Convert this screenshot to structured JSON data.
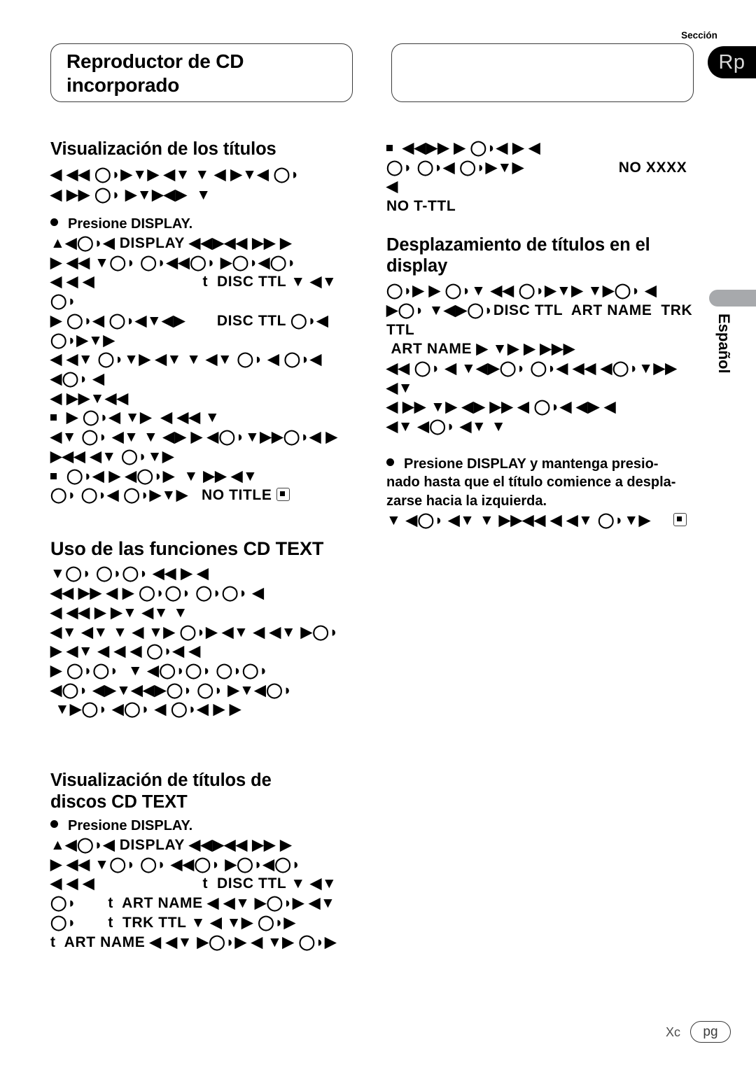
{
  "document": {
    "header": {
      "title": "Reproductor de CD\nincorporado",
      "section_label": "Sección",
      "section_badge": "Rp",
      "blank_box": ""
    },
    "side_tab": {
      "language": "Español"
    },
    "footer": {
      "code": "Xc",
      "page_badge": "pg"
    }
  },
  "left_column": {
    "heading_1": "Visualización de los títulos",
    "intro_lines": [
      "◀ ◀◀ ◯◗▶▼▶ ◀▼ ▼ ◀ ▶▼◀ ◯◗",
      "◀ ▶▶ ◯◗ ▶▼▶◀▶  ▼"
    ],
    "bullet_1": "Presione DISPLAY.",
    "body_1": [
      "▲◀◯◗◀ DISPLAY ◀◀▶◀◀ ▶▶ ▶",
      "▶ ◀◀ ▼◯◗ ◯◗◀◀◯◗ ▶◯◗◀◯◗",
      "◀ ◀ ◀                        t  DISC TTL ▼ ◀▼",
      "◯◗",
      "▶ ◯◗◀ ◯◗◀▼◀▶       DISC TTL ◯◗◀ ◯◗▶▼▶",
      "◀ ◀▼ ◯◗▼▶ ◀▼ ▼ ◀▼ ◯◗ ◀ ◯◗◀ ◀◯◗ ◀",
      "◀ ▶▶▼◀◀"
    ],
    "sub_note_1": [
      "▶ ◯◗◀ ▼▶  ◀ ◀◀ ▼",
      "◀▼ ◯◗ ◀▼ ▼ ◀▶ ▶ ◀◯◗▼▶▶◯◗◀ ▶",
      "▶◀◀ ◀▼ ◯◗▼▶"
    ],
    "sub_note_2": [
      "◯◗◀ ▶ ◀◯◗▶  ▼ ▶▶ ◀▼",
      "◯◗ ◯◗◀ ◯◗▶▼▶   NO TITLE"
    ],
    "heading_2": "Uso de las funciones CD TEXT",
    "body_2": [
      "▼◯◗ ◯◗◯◗ ◀◀ ▶ ◀",
      "◀◀ ▶▶ ◀ ▶ ◯◗◯◗ ◯◗◯◗ ◀",
      "◀ ◀◀ ▶ ▶▼ ◀▼ ▼",
      "◀▼ ◀▼ ▼ ◀ ▼▶ ◯◗▶ ◀▼ ◀ ◀▼ ▶◯◗",
      "▶ ◀▼ ◀ ◀ ◀ ◯◗◀ ◀",
      "▶ ◯◗◯◗  ▼ ◀◯◗◯◗ ◯◗◯◗",
      "◀◯◗ ◀▶▼◀◀▶◯◗ ◯◗ ▶▼◀◯◗",
      " ▼▶◯◗ ◀◯◗ ◀ ◯◗◀ ▶ ▶"
    ],
    "heading_3": "Visualización de títulos de\ndiscos CD TEXT",
    "bullet_2": "Presione DISPLAY.",
    "body_3": [
      "▲◀◯◗◀ DISPLAY ◀◀▶◀◀ ▶▶ ▶",
      "▶ ◀◀ ▼◯◗ ◯◗ ◀◀◯◗ ▶◯◗◀◯◗",
      "◀ ◀ ◀                        t  DISC TTL ▼ ◀▼",
      "◯◗       t  ART NAME ◀ ◀▼ ▶◯◗▶ ◀▼",
      "◯◗       t  TRK TTL ▼ ◀ ▼▶ ◯◗▶",
      "t  ART NAME ◀ ◀▼ ▶◯◗▶ ◀ ▼▶ ◯◗▶"
    ]
  },
  "right_column": {
    "note_top": [
      "◀◀▶▶ ▶ ◯◗◀ ▶ ◀",
      "◯◗ ◯◗◀ ◯◗▶▼▶                     NO XXXX  ◀",
      "NO T-TTL"
    ],
    "heading_1": "Desplazamiento de títulos en el\ndisplay",
    "body_1": [
      "◯◗▶ ▶ ◯◗▼ ◀◀ ◯◗▶▼▶ ▼▶◯◗ ◀",
      "▶◯◗ ▼◀▶◯◗DISC TTL  ART NAME  TRK TTL",
      " ART NAME ▶ ▼▶ ▶ ▶▶▶",
      "◀◀ ◯◗ ◀ ▼◀▶◯◗ ◯◗◀ ◀◀ ◀◯◗▼▶▶ ◀▼",
      "◀ ▶▶ ▼▶ ◀▶ ▶▶ ◀ ◯◗◀ ◀▶ ◀",
      "◀▼ ◀◯◗ ◀▼ ▼"
    ],
    "bullet_1": "Presione DISPLAY y mantenga presio-\nnado hasta que el título comience a despla-\nzarse hacia la izquierda.",
    "body_2": [
      "▼ ◀◯◗ ◀▼ ▼ ▶▶◀◀ ◀ ◀▼ ◯◗▼▶"
    ]
  }
}
